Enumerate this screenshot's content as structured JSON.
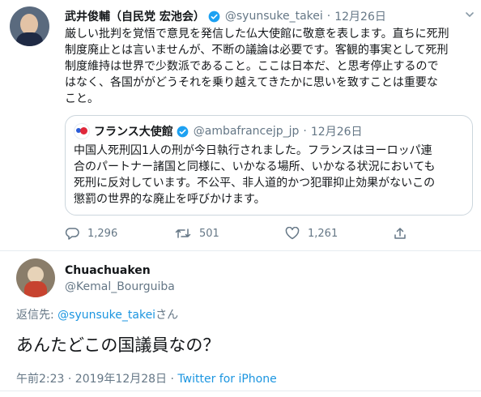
{
  "tweet": {
    "author_name": "武井俊輔（自民党 宏池会）",
    "handle": "@syunsuke_takei",
    "separator": "·",
    "date": "12月26日",
    "text_lines": [
      "厳しい批判を覚悟で意見を発信した仏大使館に敬意を表します。直ちに死刑",
      "制度廃止とは言いませんが、不断の議論は必要です。客観的事実として死刑",
      "制度維持は世界で少数派であること。ここは日本だ、と思考停止するので",
      "はなく、各国ががどうそれを乗り越えてきたかに思いを致すことは重要な",
      "こと。"
    ],
    "quote": {
      "author_name": "フランス大使館",
      "handle": "@ambafrancejp_jp",
      "separator": "·",
      "date": "12月26日",
      "text_lines": [
        "中国人死刑囚1人の刑が今日執行されました。フランスはヨーロッパ連",
        "合のパートナー諸国と同様に、いかなる場所、いかなる状況においても",
        "死刑に反対しています。不公平、非人道的かつ犯罪抑止効果がないこの",
        "懲罰の世界的な廃止を呼びかけます。"
      ]
    },
    "reply_count": "1,296",
    "retweet_count": "501",
    "like_count": "1,261"
  },
  "reply": {
    "author_name": "Chuachuaken",
    "handle": "@Kemal_Bourguiba",
    "replying_prefix": "返信先: ",
    "replying_to": "@syunsuke_takei",
    "replying_suffix": "さん",
    "text": "あんたどこの国議員なの？",
    "timestamp": "午前2:23 · 2019年12月28日 · ",
    "source": "Twitter for iPhone"
  },
  "colors": {
    "accent": "#1b95e0",
    "muted": "#657786",
    "verified": "#1da1f2"
  }
}
